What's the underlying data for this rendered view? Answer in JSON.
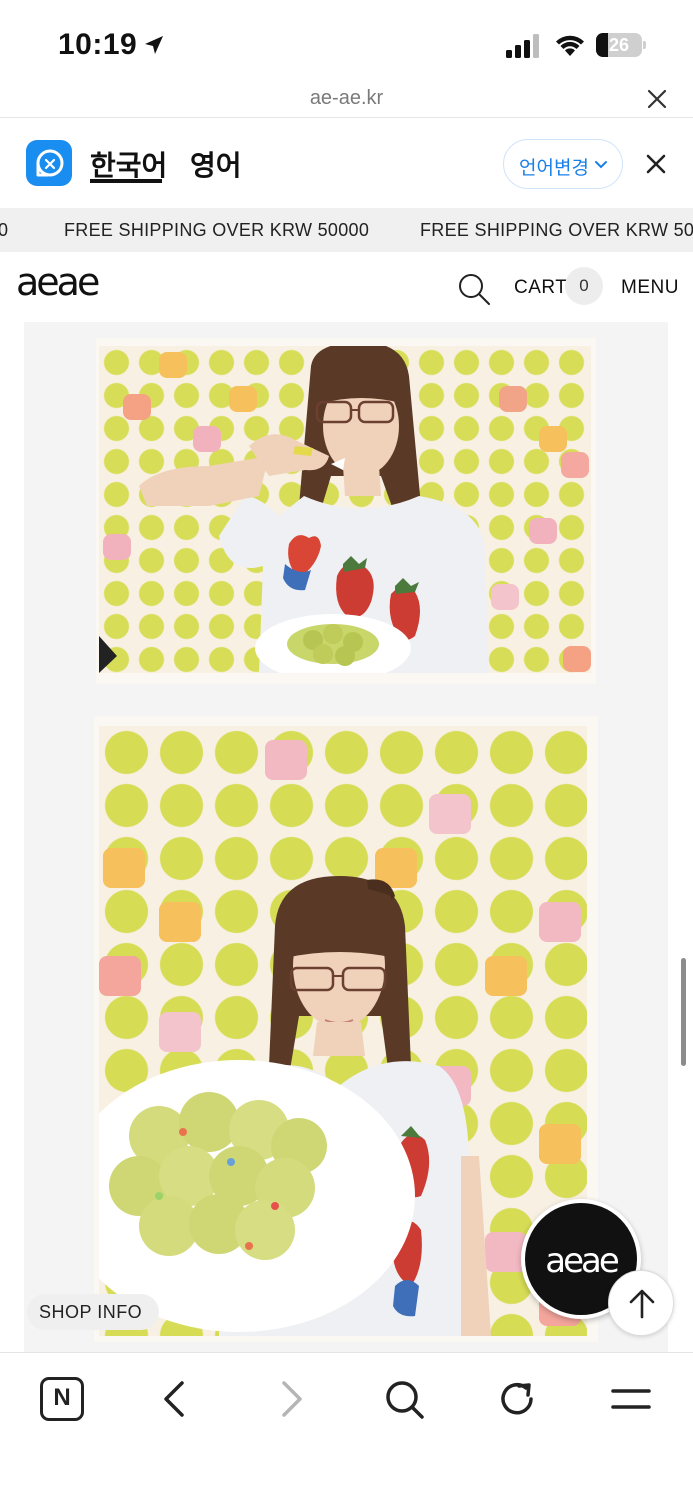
{
  "status_bar": {
    "time": "10:19",
    "battery": "26",
    "battery_level_percent": 26
  },
  "url_bar": {
    "url": "ae-ae.kr",
    "close_icon": "close-icon"
  },
  "translate_bar": {
    "lang_source": "한국어",
    "lang_target": "영어",
    "change_language": "언어변경",
    "brand_color": "#1a8df0"
  },
  "marquee": {
    "text": "FREE SHIPPING OVER KRW 50000",
    "partial_left": "0",
    "partial_right": "FREE SHIPPING OVER KRW 500"
  },
  "header": {
    "logo": "aeae",
    "cart_label": "CART",
    "cart_count": "0",
    "menu_label": "MENU"
  },
  "floating": {
    "shop_info": "SHOP INFO",
    "brand_badge": "aeae"
  },
  "bottom_bar": {
    "n_label": "N",
    "icons": [
      "naver-n-icon",
      "back-icon",
      "forward-icon",
      "search-icon",
      "reload-icon",
      "hamburger-menu-icon"
    ]
  }
}
